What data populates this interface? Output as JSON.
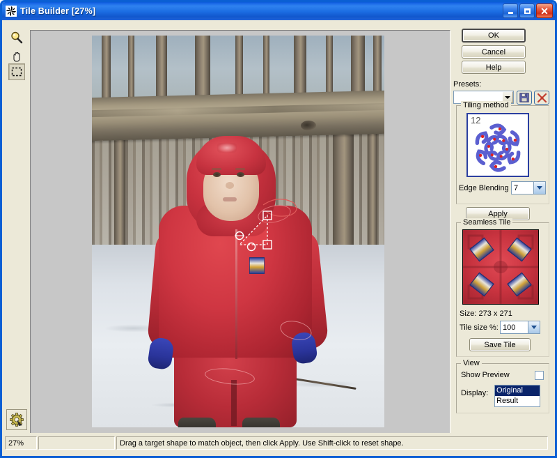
{
  "window": {
    "title": "Tile Builder [27%]",
    "icon": "pinwheel-icon",
    "minimize_label": "Minimize",
    "maximize_label": "Maximize",
    "close_label": "Close"
  },
  "toolbar": {
    "tools": [
      {
        "name": "zoom-tool",
        "icon": "magnifier-icon",
        "active": false
      },
      {
        "name": "pan-tool",
        "icon": "hand-icon",
        "active": false
      },
      {
        "name": "marquee-tool",
        "icon": "dashed-rectangle-icon",
        "active": true
      }
    ],
    "settings": {
      "name": "settings-tool",
      "icon": "gear-icon"
    }
  },
  "buttons": {
    "ok": "OK",
    "cancel": "Cancel",
    "help": "Help",
    "apply": "Apply",
    "save_tile": "Save Tile"
  },
  "presets": {
    "label": "Presets:",
    "value": "",
    "save_icon": "floppy-disk-icon",
    "delete_icon": "red-x-icon"
  },
  "tiling_method": {
    "legend": "Tiling method",
    "pattern_number": "12",
    "edge_blending_label": "Edge Blending",
    "edge_blending_value": "7"
  },
  "seamless_tile": {
    "legend": "Seamless Tile",
    "size_label": "Size: 273 x 271",
    "tile_size_label": "Tile size %:",
    "tile_size_value": "100"
  },
  "view": {
    "legend": "View",
    "show_preview_label": "Show Preview",
    "show_preview_checked": false,
    "display_label": "Display:",
    "display_options": [
      "Original",
      "Result"
    ],
    "display_selected": "Original"
  },
  "statusbar": {
    "zoom": "27%",
    "middle": "",
    "message": "Drag a target shape to match object, then click Apply. Use Shift-click to reset shape."
  },
  "colors": {
    "title_bar": "#1d6fe4",
    "dialog_face": "#ece9d8",
    "canvas_bg": "#c7c7c7",
    "selection_blue": "#0a246a",
    "tile_red": "#c8333f",
    "pattern_blue": "#5b5fd0"
  }
}
